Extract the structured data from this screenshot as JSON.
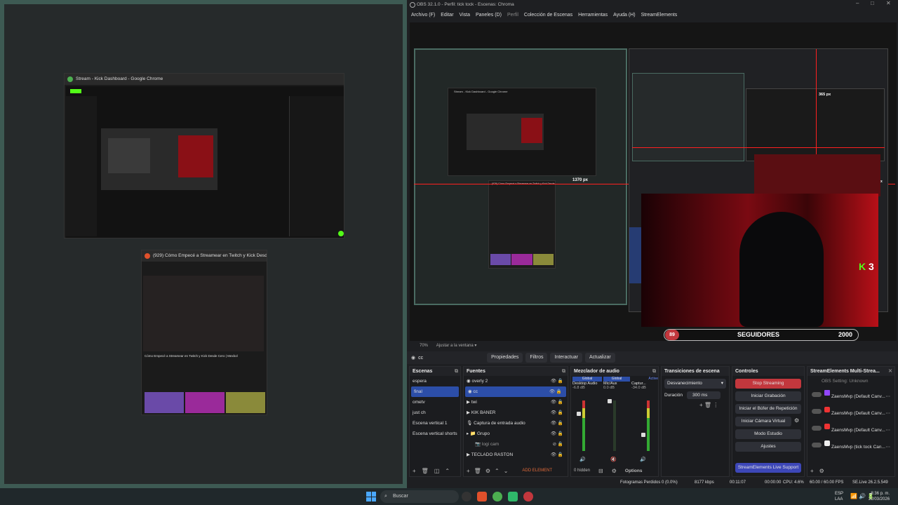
{
  "left_stage": {
    "kick_window_title": "Stream - Kick Dashboard - Google Chrome",
    "youtube_window_title": "(929) Cómo Empecé a Streamear en Twitch y Kick Desde...",
    "youtube_video_title": "Cómo Empecé a Streamear en Twitch y Kick Desde Cero | Mexbol"
  },
  "obs": {
    "title": "OBS 32.1.0 - Perfil: tick tock - Escenas: Chroma",
    "menu": [
      "Archivo (F)",
      "Editar",
      "Vista",
      "Paneles (D)",
      "Perfil",
      "Colección de Escenas",
      "Herramientas",
      "Ayuda (H)",
      "StreamElements"
    ],
    "preview": {
      "label_1370": "1370 px",
      "label_365": "365 px",
      "label_42": "42 px",
      "kick_count": "3",
      "inner_kick_title": "Stream - Kick Dashboard - Google Chrome",
      "inner_yt_title": "(929) Cómo Empecé a Streamear en Twitch y Kick Desde..."
    },
    "followers": {
      "count": "89",
      "label": "SEGUIDORES",
      "goal": "2000"
    },
    "zoom": {
      "value": "70%",
      "fit": "Ajustar a la ventana"
    },
    "source_bar": {
      "selected": "cc",
      "props": "Propiedades",
      "filters": "Filtros",
      "interact": "Interactuar",
      "refresh": "Actualizar"
    },
    "scenes": {
      "title": "Escenas",
      "items": [
        "espera",
        "final",
        "ometv",
        "just ch",
        "Escena vertical 1",
        "Escena vertical shorts"
      ],
      "selected_index": 1
    },
    "sources": {
      "title": "Fuentes",
      "items": [
        "overly 2",
        "cc",
        "twi",
        "KIK BANER",
        "Captura de entrada audio",
        "Grupo",
        "logi cam",
        "TECLADO RASTON"
      ],
      "hidden": "0 hidden",
      "add_element": "ADD ELEMENT",
      "options": "Options"
    },
    "mixer": {
      "title": "Mezclador de audio",
      "ch1": {
        "tag": "Global",
        "name": "Desktop Audio",
        "db": "-6.8 dB"
      },
      "ch2": {
        "tag": "Global",
        "name": "Mic/Aux",
        "db": "0.0 dB"
      },
      "ch3": {
        "tag": "Active",
        "name": "Captur...",
        "db": "-34.0 dB"
      }
    },
    "transitions": {
      "title": "Transiciones de escena",
      "type": "Desvanecimiento",
      "duration_label": "Duración",
      "duration": "300 ms"
    },
    "controls": {
      "title": "Controles",
      "buttons": [
        "Stop Streaming",
        "Iniciar Grabación",
        "Iniciar el Búfer de Repetición",
        "Iniciar Cámara Virtual",
        "Modo Estudio",
        "Ajustes"
      ],
      "support": "StreamElements Live Support"
    },
    "multistream": {
      "title": "StreamElements Multi-Strea...",
      "status": "OBS Setting: Unknown",
      "items": [
        "ZaensMvp (Default Canv...",
        "ZaensMvp (Default Canv...",
        "ZaensMvp (Default Canv...",
        "ZaensMvp (tick tock Can..."
      ]
    },
    "status": {
      "dropped": "Fotogramas Perdidos 0 (0.0%)",
      "bitrate": "8177 kbps",
      "time": "00:11:07",
      "rec": "00:00:00",
      "cpu": "CPU: 4.6%",
      "fps": "60.00 / 60.00 FPS",
      "se": "SE.Live 26.2.5.549"
    }
  },
  "taskbar": {
    "search": "Buscar",
    "lang": "ESP",
    "lang2": "LAA",
    "time": "8:36 p. m.",
    "date": "22/03/2026"
  },
  "colors": {
    "accent_blue": "#2c4ea8",
    "stop_red": "#c2373d",
    "kick_green": "#53fc18",
    "guide_red": "#ff2020"
  }
}
